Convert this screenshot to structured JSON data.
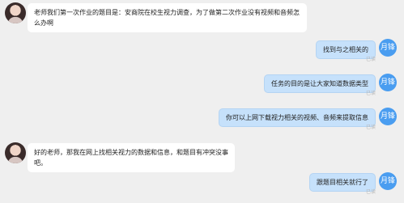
{
  "conversation": {
    "messages": [
      {
        "direction": "incoming",
        "avatar": "user-photo-avatar",
        "text": "老师我们第一次作业的题目是：安商院在校生视力调查，为了做第二次作业没有视频和音频怎么办啊"
      },
      {
        "direction": "outgoing",
        "avatar": "月锋",
        "text": "找到与之相关的",
        "status": "已读"
      },
      {
        "direction": "outgoing",
        "avatar": "月锋",
        "text": "任务的目的是让大家知道数据类型",
        "status": "已读"
      },
      {
        "direction": "outgoing",
        "avatar": "月锋",
        "text": "你可以上网下载视力相关的视频、音频来提取信息",
        "status": "已读"
      },
      {
        "direction": "incoming",
        "avatar": "user-photo-avatar",
        "text": "好的老师，那我在网上找相关视力的数据和信息，和题目有冲突没事吧。"
      },
      {
        "direction": "outgoing",
        "avatar": "月锋",
        "text": "跟题目相关就行了",
        "status": "已读"
      }
    ]
  },
  "colors": {
    "background": "#efefef",
    "incoming_bubble": "#ffffff",
    "outgoing_bubble": "#c6e1fb",
    "outgoing_border": "#b4d4f3",
    "avatar_blue": "#4a9df0",
    "status_text": "#b8b8b8"
  }
}
